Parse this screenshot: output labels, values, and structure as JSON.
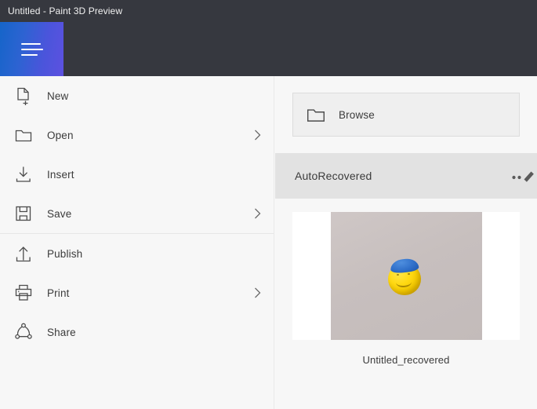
{
  "window": {
    "title": "Untitled - Paint 3D Preview",
    "titlebar_bg": "#36383f",
    "accent_gradient_from": "#1565c9",
    "accent_gradient_to": "#5d51e0"
  },
  "topbar": {
    "menu_button_name": "hamburger-menu-button",
    "menu_button_tooltip": "Menu"
  },
  "menu": {
    "items": [
      {
        "label": "New",
        "icon": "new-document-icon",
        "has_submenu": false
      },
      {
        "label": "Open",
        "icon": "folder-icon",
        "has_submenu": true
      },
      {
        "label": "Insert",
        "icon": "insert-download-icon",
        "has_submenu": false
      },
      {
        "label": "Save",
        "icon": "floppy-save-icon",
        "has_submenu": true
      },
      {
        "label": "Publish",
        "icon": "upload-icon",
        "has_submenu": false
      },
      {
        "label": "Print",
        "icon": "printer-icon",
        "has_submenu": true
      },
      {
        "label": "Share",
        "icon": "share-nodes-icon",
        "has_submenu": false
      }
    ],
    "separator_after_index": 3
  },
  "pane": {
    "browse": {
      "label": "Browse",
      "icon": "folder-icon"
    },
    "section": {
      "title": "AutoRecovered",
      "action_icon": "edit-pencil-more-icon",
      "bg": "#e2e2e2"
    },
    "recovered_items": [
      {
        "label": "Untitled_recovered",
        "thumbnail": "yellow-smiley-with-blue-cap-3d"
      }
    ]
  }
}
